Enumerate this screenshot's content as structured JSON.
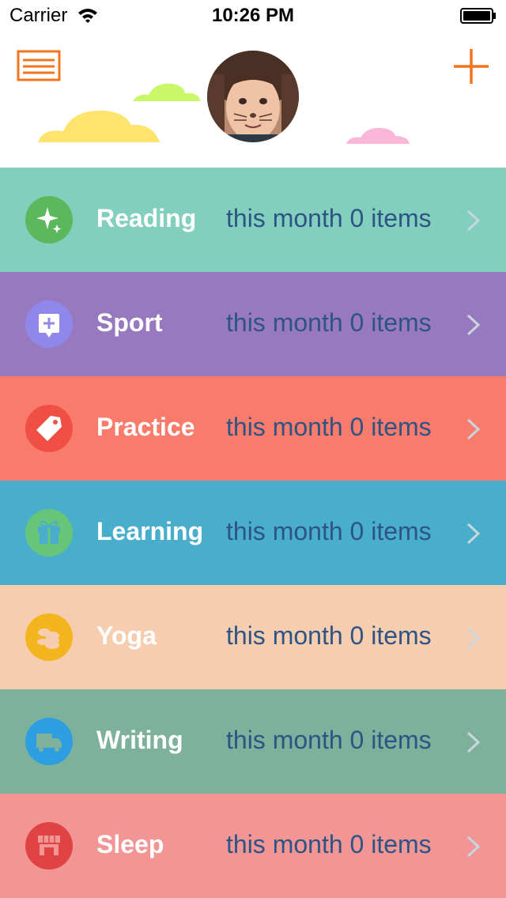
{
  "status_bar": {
    "carrier": "Carrier",
    "time": "10:26 PM"
  },
  "header": {
    "menu_icon": "menu-icon",
    "add_icon": "plus-icon",
    "accent_color": "#f5731e"
  },
  "categories": [
    {
      "label": "Reading",
      "count_text": "this month 0 items",
      "bg": "#82cfbe",
      "icon_bg": "#5cb85c",
      "icon": "sparkle-icon"
    },
    {
      "label": "Sport",
      "count_text": "this month 0 items",
      "bg": "#9879bf",
      "icon_bg": "#8f88ea",
      "icon": "plus-box-icon"
    },
    {
      "label": "Practice",
      "count_text": "this month 0 items",
      "bg": "#f87b6b",
      "icon_bg": "#f04f45",
      "icon": "tag-icon"
    },
    {
      "label": "Learning",
      "count_text": "this month 0 items",
      "bg": "#48aecb",
      "icon_bg": "#66c578",
      "icon": "gift-icon"
    },
    {
      "label": "Yoga",
      "count_text": "this month 0 items",
      "bg": "#f7cdb0",
      "icon_bg": "#f4b41e",
      "icon": "coins-icon"
    },
    {
      "label": "Writing",
      "count_text": "this month 0 items",
      "bg": "#7eb19c",
      "icon_bg": "#2d9ee0",
      "icon": "truck-icon"
    },
    {
      "label": "Sleep",
      "count_text": "this month 0 items",
      "bg": "#f19595",
      "icon_bg": "#e04343",
      "icon": "store-icon"
    }
  ]
}
